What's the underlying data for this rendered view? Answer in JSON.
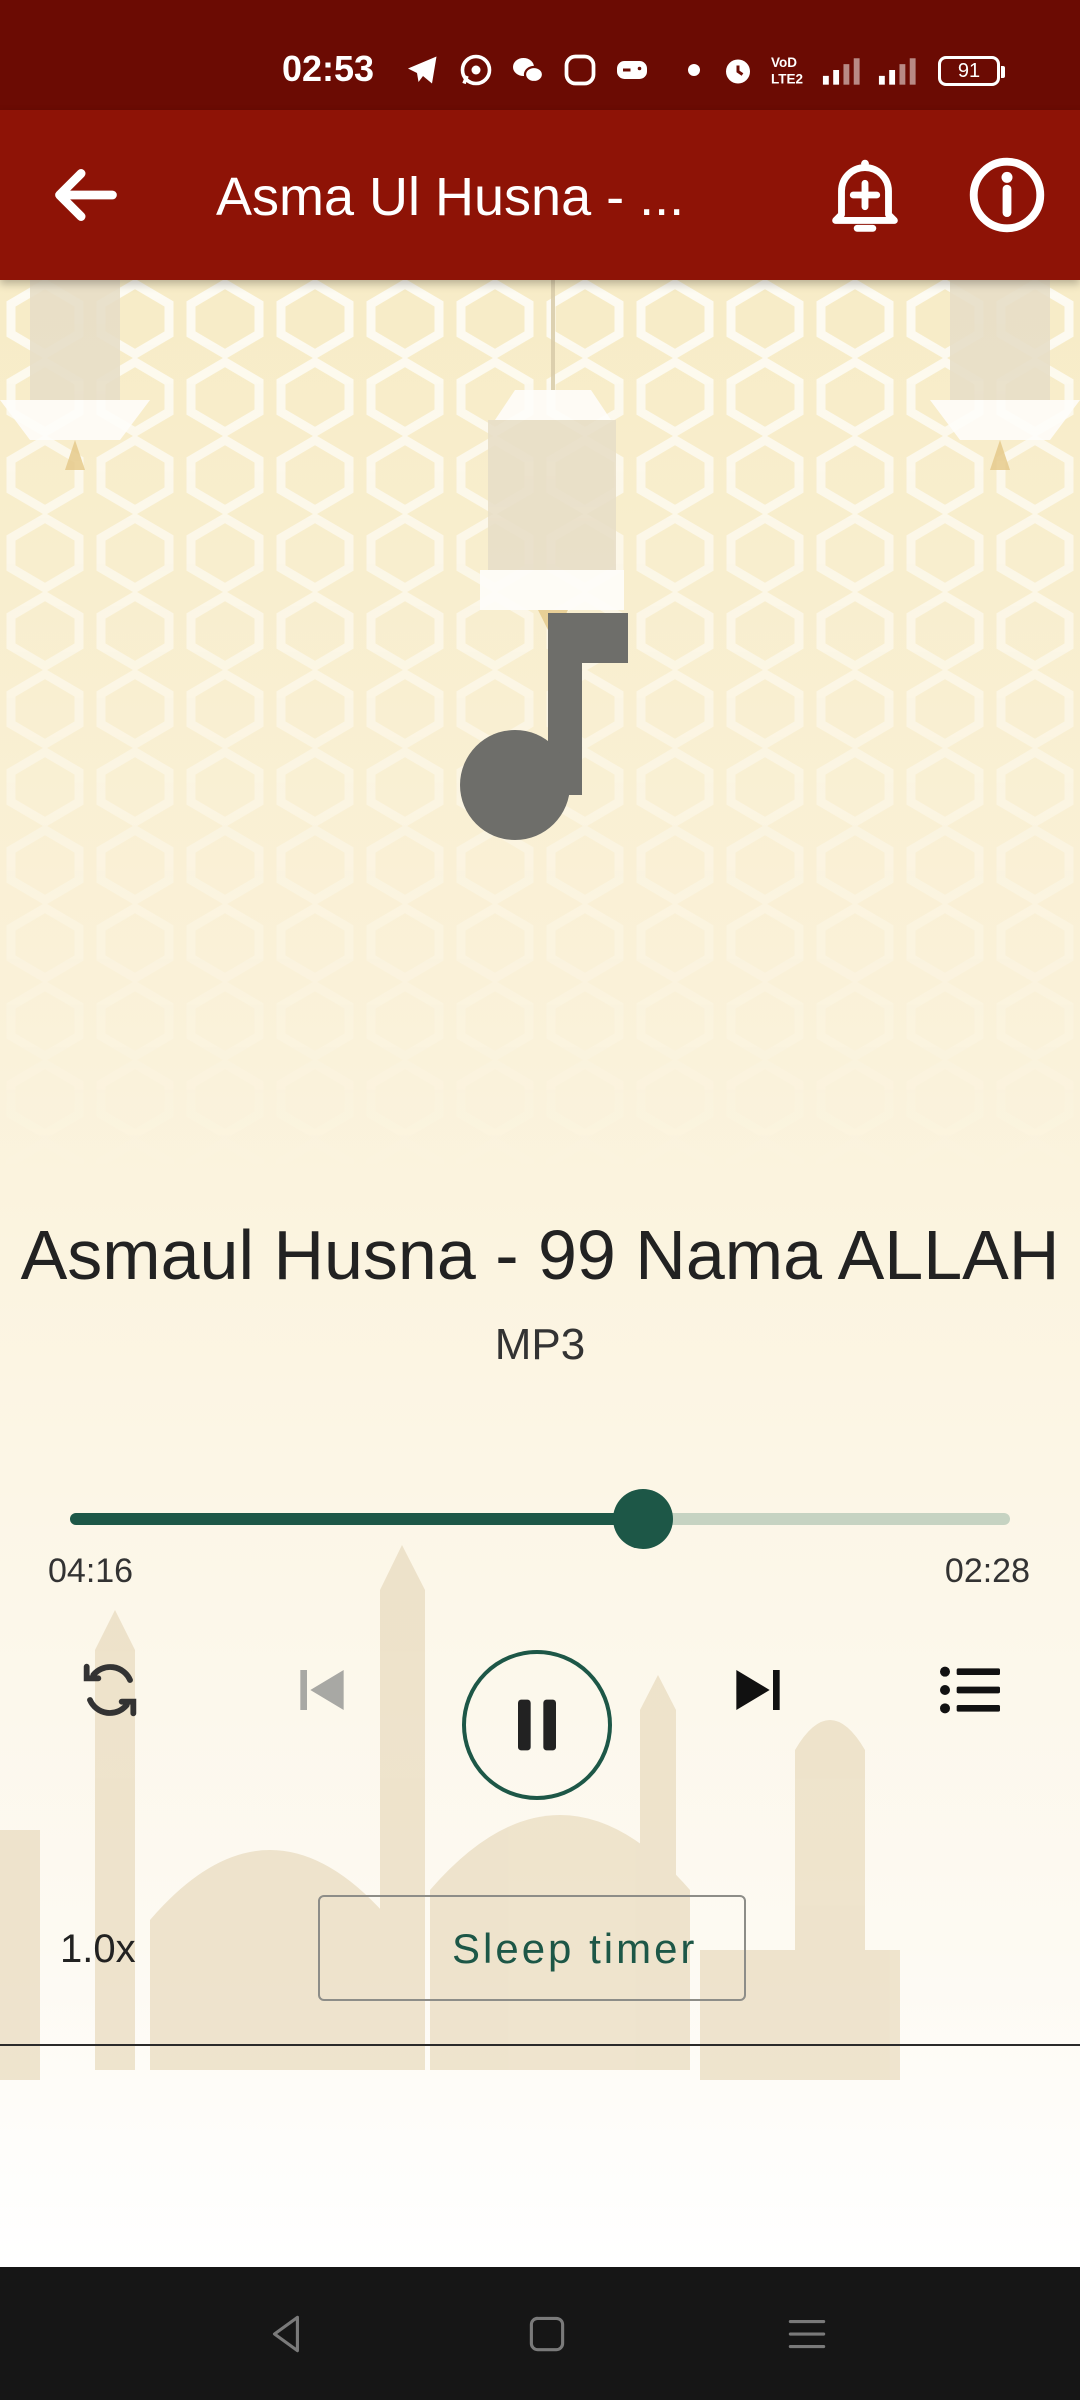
{
  "status_bar": {
    "time": "02:53",
    "battery": "91",
    "icons": [
      "telegram-icon",
      "whatsapp-icon",
      "wechat-icon",
      "notification-icon",
      "gamepad-icon",
      "dot-icon",
      "alarm-icon",
      "volte-icon",
      "signal-icon",
      "signal-icon"
    ]
  },
  "app_bar": {
    "title": "Asma Ul Husna - ...",
    "back_icon": "arrow-left-icon",
    "actions": [
      "add-alarm-bell-icon",
      "info-icon"
    ]
  },
  "player": {
    "artwork_icon": "music-note-icon",
    "title": "Asmaul Husna - 99 Nama ALLAH",
    "subtitle": "MP3",
    "progress": 0.61,
    "elapsed": "04:16",
    "remaining": "02:28",
    "speed": "1.0x",
    "sleep_timer_label": "Sleep timer",
    "state": "playing"
  },
  "colors": {
    "status_bar": "#6b0b03",
    "app_bar": "#8e1306",
    "accent": "#1d5747",
    "seek_track": "#c6d3c2"
  }
}
